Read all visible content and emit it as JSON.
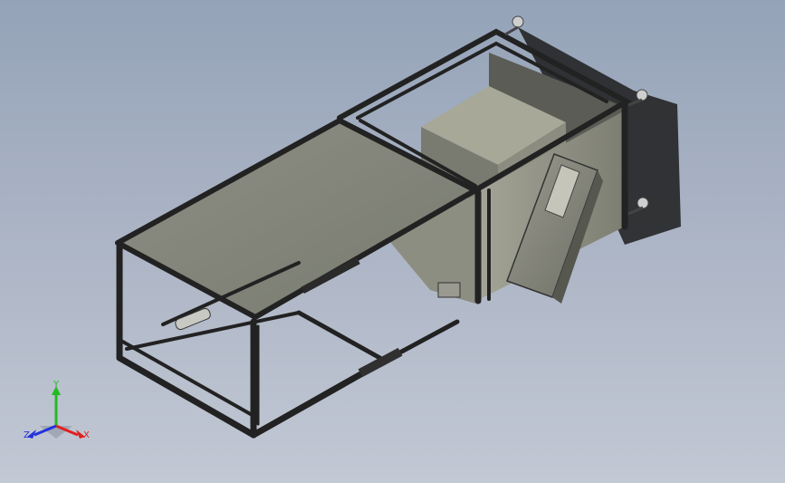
{
  "viewport": {
    "description_tag": "cad-3d-view",
    "background_top": "#94a3b8",
    "background_bottom": "#c2c8d4"
  },
  "triad": {
    "x_label": "X",
    "y_label": "Y",
    "z_label": "Z",
    "x_color": "#e02020",
    "y_color": "#22bb22",
    "z_color": "#2233dd"
  }
}
